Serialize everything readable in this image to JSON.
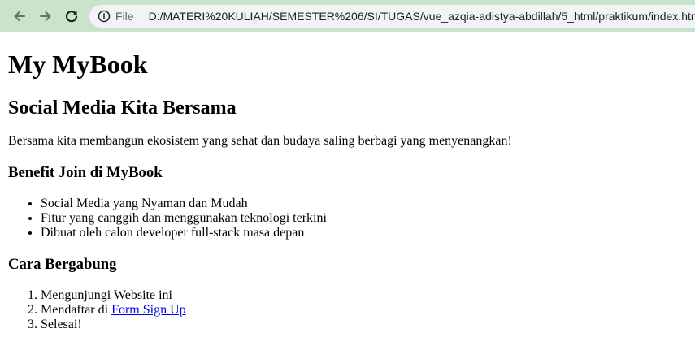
{
  "browser": {
    "scheme_label": "File",
    "url": "D:/MATERI%20KULIAH/SEMESTER%206/SI/TUGAS/vue_azqia-adistya-abdillah/5_html/praktikum/index.html",
    "toolbar_color": "#c9e4cb"
  },
  "page": {
    "title": "My MyBook",
    "subtitle": "Social Media Kita Bersama",
    "intro": "Bersama kita membangun ekosistem yang sehat dan budaya saling berbagi yang menyenangkan!",
    "benefits_heading": "Benefit Join di MyBook",
    "benefits": [
      "Social Media yang Nyaman dan Mudah",
      "Fitur yang canggih dan menggunakan teknologi terkini",
      "Dibuat oleh calon developer full-stack masa depan"
    ],
    "steps_heading": "Cara Bergabung",
    "steps": {
      "step1": "Mengunjungi Website ini",
      "step2_prefix": "Mendaftar di ",
      "step2_link": "Form Sign Up",
      "step3": "Selesai!"
    },
    "link_color": "#0000ee"
  },
  "icons": {
    "back": "arrow-left-icon",
    "forward": "arrow-right-icon",
    "reload": "reload-icon",
    "info": "info-icon"
  }
}
